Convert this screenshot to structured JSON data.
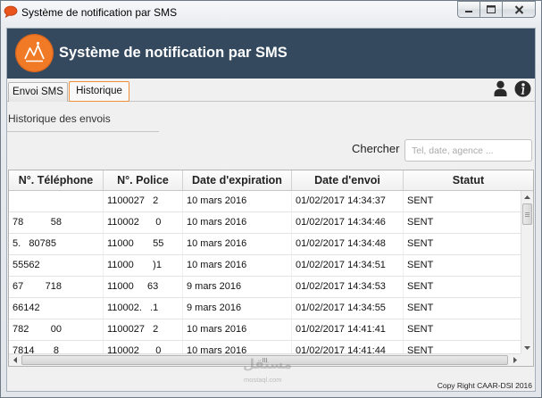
{
  "window": {
    "title": "Système de notification par SMS",
    "icon": "speech-bubble-icon"
  },
  "header": {
    "title": "Système de notification par SMS",
    "logo_icon": "orange-logo-icon"
  },
  "tabs": [
    {
      "label": "Envoi SMS",
      "selected": false
    },
    {
      "label": "Historique",
      "selected": true
    }
  ],
  "toolbar": {
    "user_icon": "user-icon",
    "info_icon": "info-icon"
  },
  "history": {
    "title": "Historique des envois",
    "search": {
      "label": "Chercher",
      "placeholder": "Tel, date, agence ...",
      "value": ""
    },
    "table": {
      "columns": [
        "N°. Téléphone",
        "N°. Police",
        "Date d'expiration",
        "Date d'envoi",
        "Statut"
      ],
      "rows": [
        {
          "phone": "",
          "policy": "1100027   2",
          "expiration": "10 mars 2016",
          "sent_at": "01/02/2017 14:34:37",
          "status": "SENT"
        },
        {
          "phone": "78          58",
          "policy": "110002      0",
          "expiration": "10 mars 2016",
          "sent_at": "01/02/2017 14:34:46",
          "status": "SENT"
        },
        {
          "phone": "5.   80785",
          "policy": "11000       55",
          "expiration": "10 mars 2016",
          "sent_at": "01/02/2017 14:34:48",
          "status": "SENT"
        },
        {
          "phone": "55562",
          "policy": "11000       )1",
          "expiration": "10 mars 2016",
          "sent_at": "01/02/2017 14:34:51",
          "status": "SENT"
        },
        {
          "phone": "67        718",
          "policy": "11000     63",
          "expiration": "9 mars 2016",
          "sent_at": "01/02/2017 14:34:53",
          "status": "SENT"
        },
        {
          "phone": "66142",
          "policy": "110002.   .1",
          "expiration": "9 mars 2016",
          "sent_at": "01/02/2017 14:34:55",
          "status": "SENT"
        },
        {
          "phone": "782        00",
          "policy": "1100027   2",
          "expiration": "10 mars 2016",
          "sent_at": "01/02/2017 14:41:41",
          "status": "SENT"
        },
        {
          "phone": "7814       8",
          "policy": "110002      0",
          "expiration": "10 mars 2016",
          "sent_at": "01/02/2017 14:41:44",
          "status": "SENT"
        }
      ]
    }
  },
  "footer": {
    "copyright": "Copy Right CAAR-DSI 2016"
  },
  "watermark": {
    "arabic": "مستقل",
    "latin": "mostaql.com"
  },
  "colors": {
    "banner": "#34495e",
    "accent": "#f0913a",
    "logo": "#f07a26",
    "title_icon": "#e8541c"
  }
}
